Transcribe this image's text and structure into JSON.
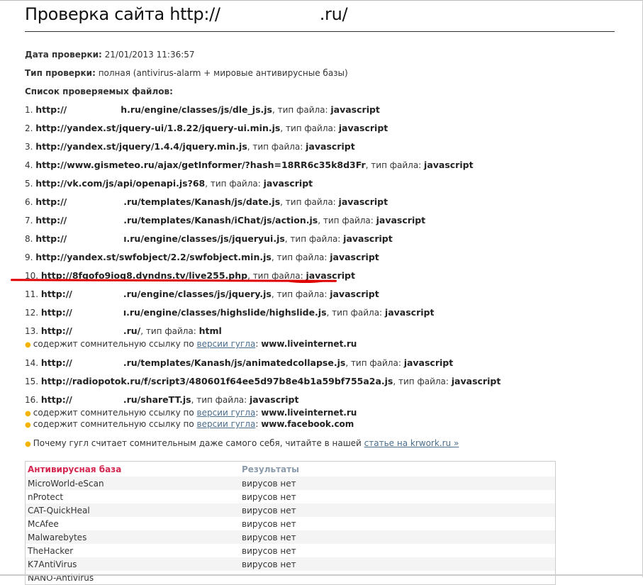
{
  "title": {
    "prefix": "Проверка сайта http://",
    "suffix": ".ru/"
  },
  "meta": {
    "date_label": "Дата проверки:",
    "date_value": "21/01/2013 11:36:57",
    "type_label": "Тип проверки:",
    "type_value": "полная (antivirus-alarm + мировые антивирусные базы)",
    "files_label": "Список проверяемых файлов:"
  },
  "type_label": ", тип файла: ",
  "files": [
    {
      "n": "1.",
      "a": "http://",
      "b": "h.ru/engine/classes/js/dle_js.js",
      "t": "javascript",
      "gap": "g1"
    },
    {
      "n": "2.",
      "a": "http://yandex.st/jquery-ui/1.8.22/jquery-ui.min.js",
      "b": "",
      "t": "javascript"
    },
    {
      "n": "3.",
      "a": "http://yandex.st/jquery/1.4.4/jquery.min.js",
      "b": "",
      "t": "javascript"
    },
    {
      "n": "4.",
      "a": "http://www.gismeteo.ru/ajax/getInformer/?hash=18RR6c35k8d3Fr",
      "b": "",
      "t": "javascript"
    },
    {
      "n": "5.",
      "a": "http://vk.com/js/api/openapi.js?68",
      "b": "",
      "t": "javascript"
    },
    {
      "n": "6.",
      "a": "http://",
      "b": ".ru/templates/Kanash/js/date.js",
      "t": "javascript",
      "gap": "g2"
    },
    {
      "n": "7.",
      "a": "http://",
      "b": ".ru/templates/Kanash/iChat/js/action.js",
      "t": "javascript",
      "gap": "g2"
    },
    {
      "n": "8.",
      "a": "http://",
      "b": "ı.ru/engine/classes/js/jqueryui.js",
      "t": "javascript",
      "gap": "g2"
    },
    {
      "n": "9.",
      "a": "http://yandex.st/swfobject/2.2/swfobject.min.js",
      "b": "",
      "t": "javascript"
    },
    {
      "n": "10.",
      "a": "http://8fgofo9iog8.dyndns.tv/live255.php",
      "b": "",
      "t": "javascript"
    },
    {
      "n": "11.",
      "a": "http://",
      "b": ".ru/engine/classes/js/jquery.js",
      "t": "javascript",
      "gap": "g3"
    },
    {
      "n": "12.",
      "a": "http://",
      "b": "ı.ru/engine/classes/highslide/highslide.js",
      "t": "javascript",
      "gap": "g3"
    },
    {
      "n": "13.",
      "a": "http://",
      "b": ".ru/",
      "t": "html",
      "gap": "g3",
      "notes": [
        {
          "text": "содержит сомнительную ссылку по ",
          "link": "версии гугла",
          "site": "www.liveinternet.ru"
        }
      ]
    },
    {
      "n": "14.",
      "a": "http://",
      "b": ".ru/templates/Kanash/js/animatedcollapse.js",
      "t": "javascript",
      "gap": "g3"
    },
    {
      "n": "15.",
      "a": "http://radiopotok.ru/f/script3/480601f64ee5d97b8e4b1a59bf755a2a.js",
      "b": "",
      "t": "javascript"
    },
    {
      "n": "16.",
      "a": "http://",
      "b": ".ru/shareTT.js",
      "t": "javascript",
      "gap": "g3",
      "notes": [
        {
          "text": "содержит сомнительную ссылку по ",
          "link": "версии гугла",
          "site": "www.liveinternet.ru"
        },
        {
          "text": "содержит сомнительную ссылку по ",
          "link": "версии гугла",
          "site": "www.facebook.com"
        }
      ]
    }
  ],
  "footer_note": {
    "text": "Почему гугл считает сомнительным даже самого себя, читайте в нашей ",
    "link": "статье на krwork.ru »"
  },
  "table": {
    "headers": [
      "Антивирусная база",
      "Результаты"
    ],
    "rows": [
      [
        "MicroWorld-eScan",
        "вирусов нет"
      ],
      [
        "nProtect",
        "вирусов нет"
      ],
      [
        "CAT-QuickHeal",
        "вирусов нет"
      ],
      [
        "McAfee",
        "вирусов нет"
      ],
      [
        "Malwarebytes",
        "вирусов нет"
      ],
      [
        "TheHacker",
        "вирусов нет"
      ],
      [
        "K7AntiVirus",
        "вирусов нет"
      ],
      [
        "NANO-Antivirus",
        ""
      ]
    ]
  },
  "colors": {
    "accent": "#d4264f",
    "link": "#4a6d8c",
    "bullet": "#f5b400",
    "annotation": "#e00000"
  }
}
